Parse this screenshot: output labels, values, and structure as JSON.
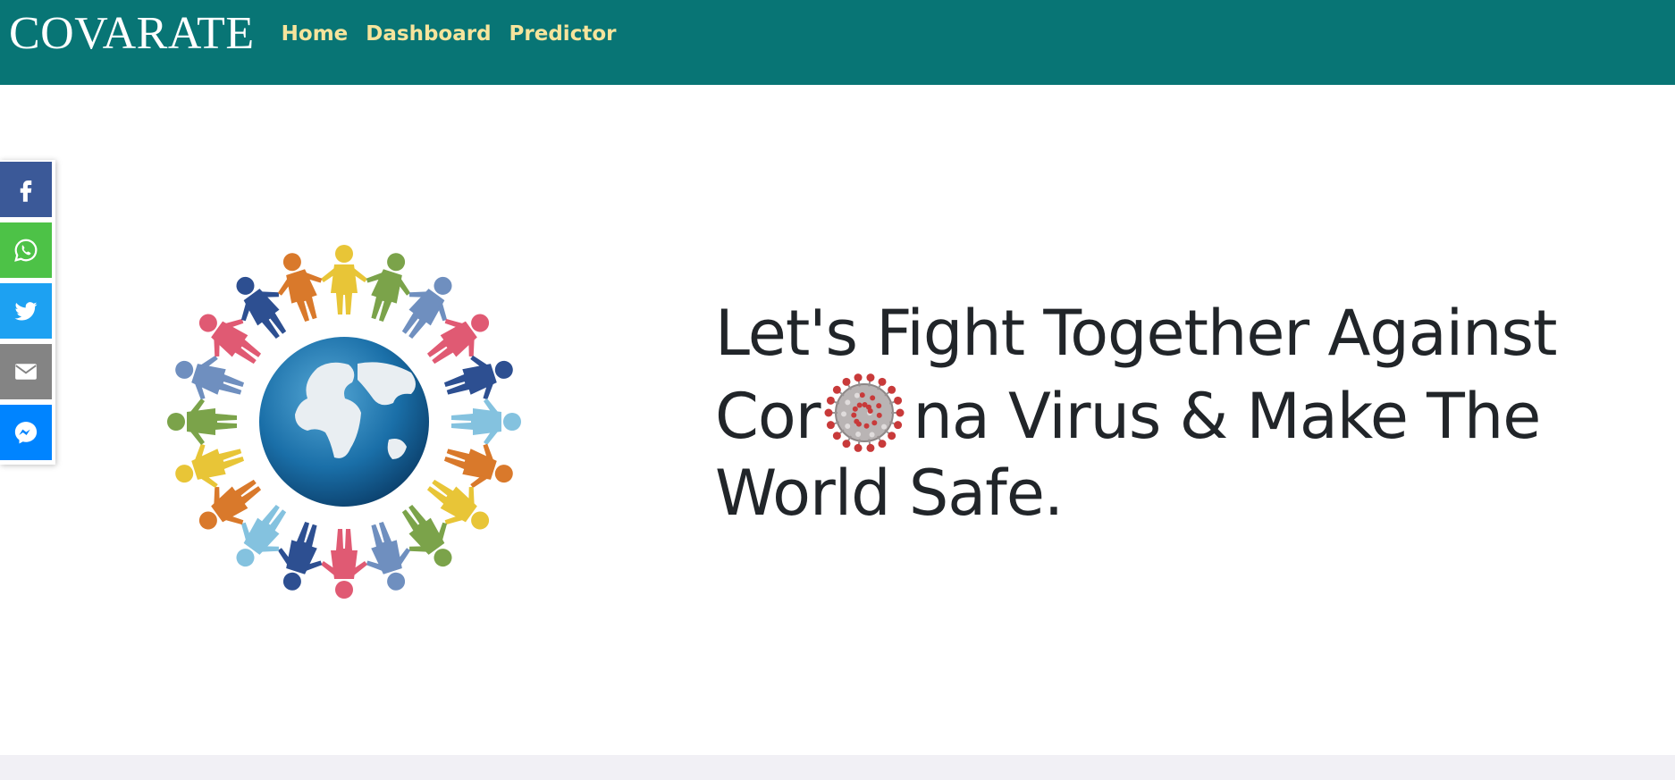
{
  "navbar": {
    "brand": "COVARATE",
    "links": [
      {
        "label": "Home"
      },
      {
        "label": "Dashboard"
      },
      {
        "label": "Predictor"
      }
    ]
  },
  "share_bar": {
    "buttons": [
      {
        "name": "facebook",
        "icon": "facebook-icon",
        "color": "#3b5998"
      },
      {
        "name": "whatsapp",
        "icon": "whatsapp-icon",
        "color": "#4dc247"
      },
      {
        "name": "twitter",
        "icon": "twitter-icon",
        "color": "#1da1f2"
      },
      {
        "name": "email",
        "icon": "email-icon",
        "color": "#848484"
      },
      {
        "name": "messenger",
        "icon": "messenger-icon",
        "color": "#0084ff"
      }
    ]
  },
  "hero": {
    "headline_part1": "Let's Fight Together Against Cor",
    "headline_part2": "na Virus & Make The World Safe.",
    "illustration": "people-around-globe-icon",
    "inline_image": "coronavirus-icon"
  },
  "colors": {
    "navbar_bg": "#087575",
    "nav_link": "#f6e49c",
    "headline": "#212529",
    "footer_strip": "#f1f0f5"
  }
}
